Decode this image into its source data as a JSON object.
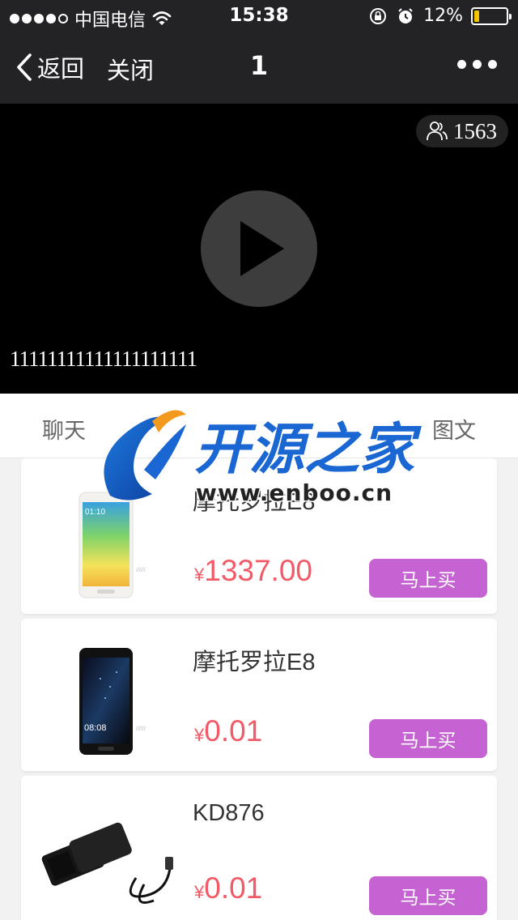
{
  "status_bar": {
    "carrier": "中国电信",
    "time": "15:38",
    "battery": "12%",
    "battery_level": 0.12
  },
  "nav": {
    "back_label": "返回",
    "close_label": "关闭",
    "title": "1"
  },
  "video": {
    "viewer_count": "1563",
    "caption": "11111111111111111111"
  },
  "tabs": [
    {
      "label": "聊天"
    },
    {
      "label": "图文"
    }
  ],
  "watermark": {
    "title": "开源之家",
    "url": "www.enboo.cn"
  },
  "products": [
    {
      "name": "摩托罗拉E8",
      "currency": "¥",
      "price": "1337.00",
      "buy_label": "马上买",
      "image": "white-smartphone"
    },
    {
      "name": "摩托罗拉E8",
      "currency": "¥",
      "price": "0.01",
      "buy_label": "马上买",
      "image": "black-smartphone"
    },
    {
      "name": "KD876",
      "currency": "¥",
      "price": "0.01",
      "buy_label": "马上买",
      "image": "battery-case"
    }
  ],
  "colors": {
    "bar_bg": "#232326",
    "price": "#f25a67",
    "buy_button": "#c463d1"
  }
}
